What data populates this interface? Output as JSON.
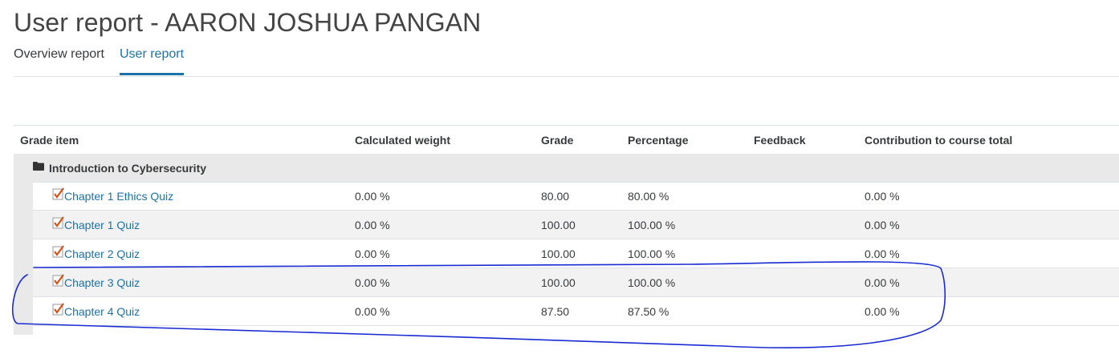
{
  "page": {
    "title": "User report - AARON JOSHUA PANGAN"
  },
  "tabs": [
    {
      "label": "Overview report",
      "active": false
    },
    {
      "label": "User report",
      "active": true
    }
  ],
  "table": {
    "headers": [
      "Grade item",
      "Calculated weight",
      "Grade",
      "Percentage",
      "Feedback",
      "Contribution to course total"
    ],
    "category": {
      "icon": "folder-icon",
      "label": "Introduction to Cybersecurity"
    },
    "rows": [
      {
        "name": "Chapter 1 Ethics Quiz",
        "weight": "0.00 %",
        "grade": "80.00",
        "percentage": "80.00 %",
        "feedback": "",
        "contribution": "0.00 %"
      },
      {
        "name": "Chapter 1 Quiz",
        "weight": "0.00 %",
        "grade": "100.00",
        "percentage": "100.00 %",
        "feedback": "",
        "contribution": "0.00 %"
      },
      {
        "name": "Chapter 2 Quiz",
        "weight": "0.00 %",
        "grade": "100.00",
        "percentage": "100.00 %",
        "feedback": "",
        "contribution": "0.00 %"
      },
      {
        "name": "Chapter 3 Quiz",
        "weight": "0.00 %",
        "grade": "100.00",
        "percentage": "100.00 %",
        "feedback": "",
        "contribution": "0.00 %"
      },
      {
        "name": "Chapter 4 Quiz",
        "weight": "0.00 %",
        "grade": "87.50",
        "percentage": "87.50 %",
        "feedback": "",
        "contribution": "0.00 %"
      }
    ],
    "item_icon": "quiz-icon"
  },
  "annotation": {
    "type": "hand-drawn circle",
    "color": "#1a2bd1"
  },
  "colors": {
    "link": "#1a73a8",
    "category_bg": "#e9e9e9",
    "alt_row_bg": "#f2f2f2"
  }
}
